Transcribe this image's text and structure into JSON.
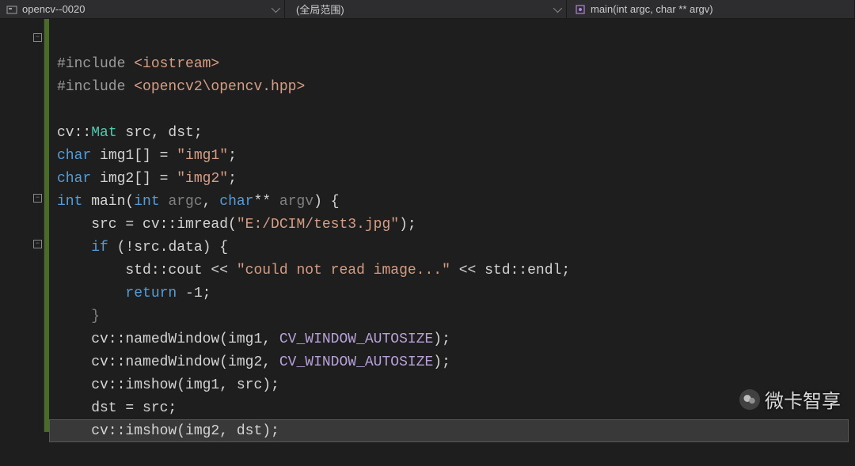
{
  "topbar": {
    "project": "opencv--0020",
    "scope": "(全局范围)",
    "func": "main(int argc, char ** argv)"
  },
  "code": {
    "l1_a": "#include ",
    "l1_b": "<iostream>",
    "l2_a": "#include ",
    "l2_b": "<opencv2\\opencv.hpp>",
    "l4_a": "cv::",
    "l4_b": "Mat",
    "l4_c": " src, dst;",
    "l5_a": "char",
    "l5_b": " img1[] = ",
    "l5_c": "\"img1\"",
    "l5_d": ";",
    "l6_a": "char",
    "l6_b": " img2[] = ",
    "l6_c": "\"img2\"",
    "l6_d": ";",
    "l7_a": "int",
    "l7_b": " main(",
    "l7_c": "int",
    "l7_d": " ",
    "l7_e": "argc",
    "l7_f": ", ",
    "l7_g": "char",
    "l7_h": "** ",
    "l7_i": "argv",
    "l7_j": ") {",
    "l8_a": "    src = cv::imread(",
    "l8_b": "\"E:/DCIM/test3.jpg\"",
    "l8_c": ");",
    "l9_a": "    ",
    "l9_b": "if",
    "l9_c": " (!src.data) {",
    "l10_a": "        std::cout << ",
    "l10_b": "\"could not read image...\"",
    "l10_c": " << std::endl;",
    "l11_a": "        ",
    "l11_b": "return",
    "l11_c": " -1;",
    "l12_a": "    }",
    "l13_a": "    cv::namedWindow(img1, ",
    "l13_b": "CV_WINDOW_AUTOSIZE",
    "l13_c": ");",
    "l14_a": "    cv::namedWindow(img2, ",
    "l14_b": "CV_WINDOW_AUTOSIZE",
    "l14_c": ");",
    "l15_a": "    cv::imshow(img1, src);",
    "l16_a": "    dst = src;",
    "l17_a": "    cv::imshow(img2, dst);"
  },
  "watermark": {
    "text": "微卡智享"
  }
}
